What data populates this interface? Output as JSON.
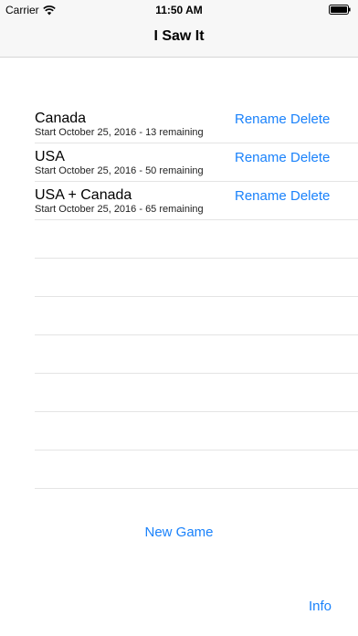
{
  "status_bar": {
    "carrier": "Carrier",
    "time": "11:50 AM"
  },
  "nav": {
    "title": "I Saw It"
  },
  "games": [
    {
      "name": "Canada",
      "subtitle": "Start October 25, 2016 - 13 remaining",
      "rename_label": "Rename",
      "delete_label": "Delete"
    },
    {
      "name": "USA",
      "subtitle": "Start October 25, 2016 - 50 remaining",
      "rename_label": "Rename",
      "delete_label": "Delete"
    },
    {
      "name": "USA + Canada",
      "subtitle": "Start October 25, 2016 - 65 remaining",
      "rename_label": "Rename",
      "delete_label": "Delete"
    }
  ],
  "actions": {
    "new_game_label": "New Game",
    "info_label": "Info"
  },
  "colors": {
    "accent": "#1a82fb",
    "bar_background": "#f7f7f7"
  }
}
